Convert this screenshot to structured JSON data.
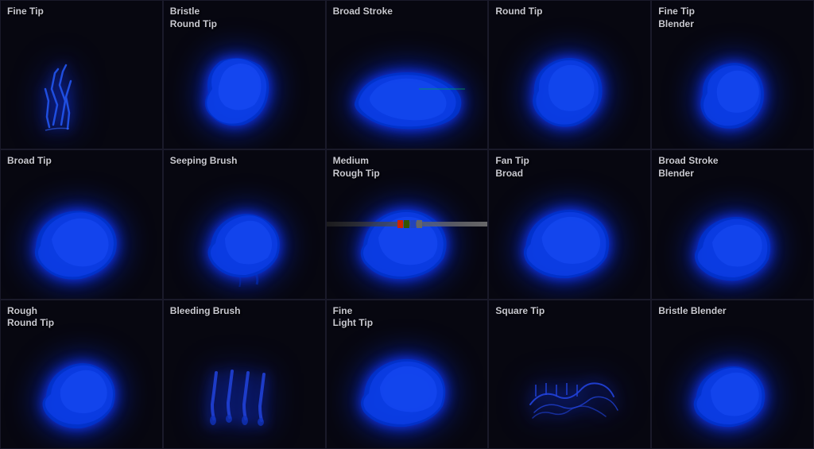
{
  "brushes": [
    {
      "id": "fine-tip",
      "label": "Fine Tip",
      "row": 0,
      "col": 0,
      "shape": "strokes"
    },
    {
      "id": "bristle-round-tip",
      "label": "Bristle\nRound Tip",
      "row": 0,
      "col": 1,
      "shape": "blob-med"
    },
    {
      "id": "broad-stroke-top",
      "label": "Broad Stroke",
      "row": 0,
      "col": 2,
      "shape": "blob-wide"
    },
    {
      "id": "round-tip-top",
      "label": "Round Tip",
      "row": 0,
      "col": 3,
      "shape": "blob-round"
    },
    {
      "id": "fine-tip-blender",
      "label": "Fine Tip\nBlender",
      "row": 0,
      "col": 4,
      "shape": "blob-round-sm"
    },
    {
      "id": "broad-tip",
      "label": "Broad Tip",
      "row": 1,
      "col": 0,
      "shape": "blob-broad"
    },
    {
      "id": "seeping-brush",
      "label": "Seeping Brush",
      "row": 1,
      "col": 1,
      "shape": "blob-seep"
    },
    {
      "id": "medium-rough-tip",
      "label": "Medium\nRough Tip",
      "row": 1,
      "col": 2,
      "shape": "blob-med-rough",
      "has_slider": true
    },
    {
      "id": "fan-tip-broad",
      "label": "Fan Tip\nBroad",
      "row": 1,
      "col": 3,
      "shape": "blob-fan"
    },
    {
      "id": "broad-stroke-blender",
      "label": "Broad Stroke\nBlender",
      "row": 1,
      "col": 4,
      "shape": "blob-blender"
    },
    {
      "id": "rough-round-tip",
      "label": "Rough\nRound Tip",
      "row": 2,
      "col": 0,
      "shape": "blob-rough-round"
    },
    {
      "id": "bleeding-brush",
      "label": "Bleeding Brush",
      "row": 2,
      "col": 1,
      "shape": "drips"
    },
    {
      "id": "fine-light-tip",
      "label": "Fine\nLight Tip",
      "row": 2,
      "col": 2,
      "shape": "blob-light"
    },
    {
      "id": "square-tip",
      "label": "Square Tip",
      "row": 2,
      "col": 3,
      "shape": "strokes-fine"
    },
    {
      "id": "bristle-blender",
      "label": "Bristle Blender",
      "row": 2,
      "col": 4,
      "shape": "blob-bristle"
    }
  ]
}
